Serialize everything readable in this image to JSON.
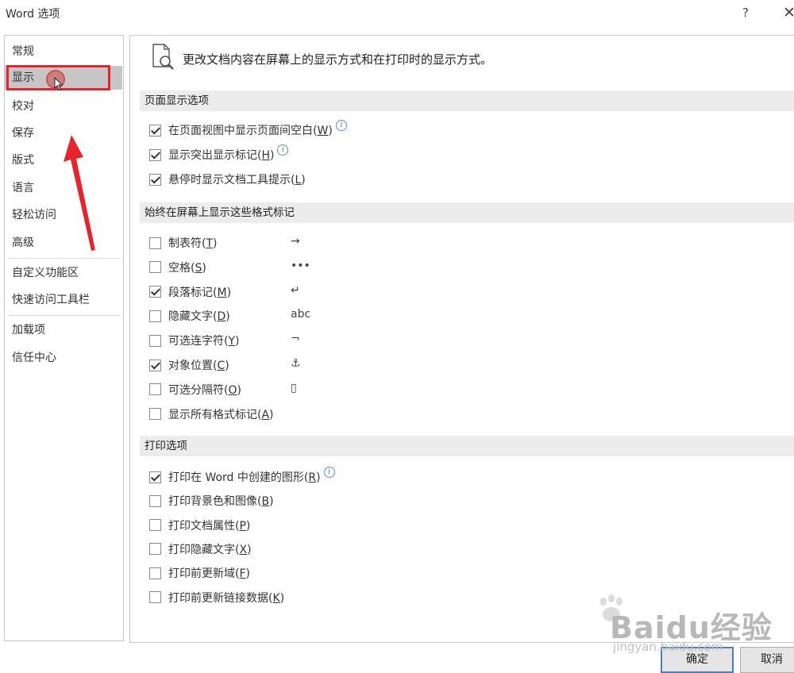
{
  "window": {
    "title": "Word 选项",
    "help": "?",
    "close": "✕"
  },
  "nav": {
    "items": [
      "常规",
      "显示",
      "校对",
      "保存",
      "版式",
      "语言",
      "轻松访问",
      "高级",
      "自定义功能区",
      "快速访问工具栏",
      "加载项",
      "信任中心"
    ],
    "selected": "显示"
  },
  "content": {
    "header": "更改文档内容在屏幕上的显示方式和在打印时的显示方式。",
    "page_display": {
      "title": "页面显示选项",
      "options": [
        {
          "pre": "在页面视图中显示页面间空白(",
          "key": "W",
          "post": ")",
          "checked": true,
          "info": true
        },
        {
          "pre": "显示突出显示标记(",
          "key": "H",
          "post": ")",
          "checked": true,
          "info": true
        },
        {
          "pre": "悬停时显示文档工具提示(",
          "key": "L",
          "post": ")",
          "checked": true,
          "info": false
        }
      ]
    },
    "format_marks": {
      "title": "始终在屏幕上显示这些格式标记",
      "options": [
        {
          "pre": "制表符(",
          "key": "T",
          "post": ")",
          "checked": false,
          "symbol": "→"
        },
        {
          "pre": "空格(",
          "key": "S",
          "post": ")",
          "checked": false,
          "symbol": "•••"
        },
        {
          "pre": "段落标记(",
          "key": "M",
          "post": ")",
          "checked": true,
          "symbol": "↵"
        },
        {
          "pre": "隐藏文字(",
          "key": "D",
          "post": ")",
          "checked": false,
          "symbol": "abc"
        },
        {
          "pre": "可选连字符(",
          "key": "Y",
          "post": ")",
          "checked": false,
          "symbol": "¬"
        },
        {
          "pre": "对象位置(",
          "key": "C",
          "post": ")",
          "checked": true,
          "symbol": "⚓"
        },
        {
          "pre": "可选分隔符(",
          "key": "O",
          "post": ")",
          "checked": false,
          "symbol": "▯"
        },
        {
          "pre": "显示所有格式标记(",
          "key": "A",
          "post": ")",
          "checked": false,
          "symbol": ""
        }
      ]
    },
    "print": {
      "title": "打印选项",
      "options": [
        {
          "pre": "打印在 Word 中创建的图形(",
          "key": "R",
          "post": ")",
          "checked": true,
          "info": true
        },
        {
          "pre": "打印背景色和图像(",
          "key": "B",
          "post": ")",
          "checked": false,
          "info": false
        },
        {
          "pre": "打印文档属性(",
          "key": "P",
          "post": ")",
          "checked": false,
          "info": false
        },
        {
          "pre": "打印隐藏文字(",
          "key": "X",
          "post": ")",
          "checked": false,
          "info": false
        },
        {
          "pre": "打印前更新域(",
          "key": "F",
          "post": ")",
          "checked": false,
          "info": false
        },
        {
          "pre": "打印前更新链接数据(",
          "key": "K",
          "post": ")",
          "checked": false,
          "info": false
        }
      ]
    }
  },
  "buttons": {
    "ok": "确定",
    "cancel": "取消"
  },
  "watermark": {
    "text": "Baidu经验",
    "url": "jingyan.baidu.com"
  },
  "colors": {
    "annotation_red": "#e8232b",
    "selected_bg": "#c6c6c6",
    "section_bg": "#ececec",
    "ok_border": "#4a7cc4"
  }
}
